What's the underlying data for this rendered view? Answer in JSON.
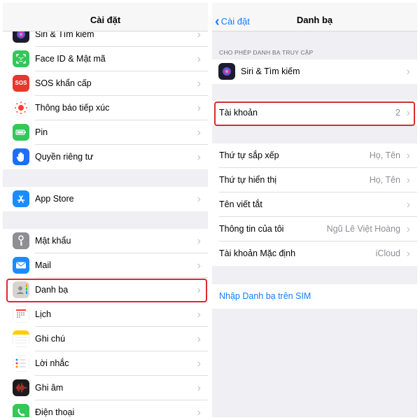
{
  "left": {
    "title": "Cài đặt",
    "items": [
      {
        "label": "Siri & Tìm kiếm",
        "icon": "siri-icon"
      },
      {
        "label": "Face ID & Mật mã",
        "icon": "face-id-icon"
      },
      {
        "label": "SOS khẩn cấp",
        "icon": "sos-icon",
        "icon_text": "SOS"
      },
      {
        "label": "Thông báo tiếp xúc",
        "icon": "exposure-notification-icon"
      },
      {
        "label": "Pin",
        "icon": "battery-icon"
      },
      {
        "label": "Quyền riêng tư",
        "icon": "privacy-hand-icon"
      },
      {
        "label": "App Store",
        "icon": "app-store-icon"
      },
      {
        "label": "Mật khẩu",
        "icon": "key-icon"
      },
      {
        "label": "Mail",
        "icon": "mail-icon"
      },
      {
        "label": "Danh bạ",
        "icon": "contacts-icon"
      },
      {
        "label": "Lịch",
        "icon": "calendar-icon"
      },
      {
        "label": "Ghi chú",
        "icon": "notes-icon"
      },
      {
        "label": "Lời nhắc",
        "icon": "reminders-icon"
      },
      {
        "label": "Ghi âm",
        "icon": "voice-memos-icon"
      },
      {
        "label": "Điện thoại",
        "icon": "phone-icon"
      }
    ]
  },
  "right": {
    "back_label": "Cài đặt",
    "title": "Danh bạ",
    "section_header": "CHO PHÉP DANH BẠ TRUY CẬP",
    "siri_row": {
      "label": "Siri & Tìm kiếm",
      "icon": "siri-icon"
    },
    "accounts_row": {
      "label": "Tài khoản",
      "value": "2"
    },
    "settings_rows": [
      {
        "label": "Thứ tự sắp xếp",
        "value": "Họ, Tên"
      },
      {
        "label": "Thứ tự hiển thị",
        "value": "Họ, Tên"
      },
      {
        "label": "Tên viết tắt",
        "value": ""
      },
      {
        "label": "Thông tin của tôi",
        "value": "Ngũ Lê Việt Hoàng"
      },
      {
        "label": "Tài khoản Mặc định",
        "value": "iCloud"
      }
    ],
    "import_sim_label": "Nhập Danh bạ trên SIM"
  },
  "colors": {
    "accent": "#147efb",
    "highlight": "#d92b2b",
    "background": "#efeff4"
  }
}
